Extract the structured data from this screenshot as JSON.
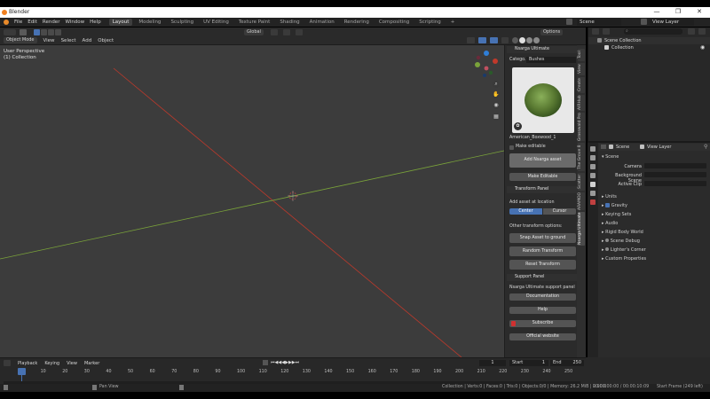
{
  "window": {
    "title": "Blender",
    "controls": [
      "—",
      "❐",
      "✕"
    ]
  },
  "menubar": {
    "menus": [
      "File",
      "Edit",
      "Render",
      "Window",
      "Help"
    ],
    "workspaces": [
      "Layout",
      "Modeling",
      "Sculpting",
      "UV Editing",
      "Texture Paint",
      "Shading",
      "Animation",
      "Rendering",
      "Compositing",
      "Scripting"
    ],
    "active_workspace": "Layout",
    "add_tab": "+",
    "scene": "Scene",
    "view_layer": "View Layer"
  },
  "viewport_header": {
    "mode": "Object Mode",
    "menus": [
      "View",
      "Select",
      "Add",
      "Object"
    ],
    "transform_orientation": "Global",
    "options": "Options"
  },
  "viewport": {
    "view_name": "User Perspective",
    "collection": "(1) Collection",
    "gizmo_axes": [
      "X",
      "Y",
      "Z"
    ]
  },
  "npanel": {
    "title": "Nsarga Ultimate",
    "category_label": "Catego...",
    "category_value": "Bushes",
    "asset_name": "American_Boxwood_1",
    "make_editable": "Make editable",
    "add_button": "Add Nsarga asset",
    "more_editable": "Make Editable",
    "transform_panel": "Transform Panel",
    "add_at_location": "Add asset at location",
    "location_options": [
      "Center",
      "Cursor"
    ],
    "location_active": "Center",
    "other_options": "Other transform options:",
    "snap_button": "Snap Asset to ground",
    "random_button": "Random Transform",
    "reset_button": "Reset Transform",
    "support_panel": "Support Panel",
    "support_label": "Nsarga Ultimate support panel",
    "documentation": "Documentation",
    "help": "Help",
    "subscribe": "Subscribe",
    "website": "Official website"
  },
  "vtabs": [
    "Tool",
    "View",
    "Create",
    "AIRHub",
    "Grasswald Pro",
    "The Grove 8",
    "Scatter",
    "ARAMOO",
    "Nsarga Ultimate"
  ],
  "outliner": {
    "search_placeholder": "",
    "root": "Scene Collection",
    "children": [
      "Collection"
    ]
  },
  "properties": {
    "scene_label": "Scene",
    "view_layer": "View Layer",
    "section_scene": "Scene",
    "camera_label": "Camera",
    "bg_scene_label": "Background Scene",
    "active_clip_label": "Active Clip",
    "sections": [
      "Units",
      "Gravity",
      "Keying Sets",
      "Audio",
      "Rigid Body World",
      "Scene Debug",
      "Lighter's Corner",
      "Custom Properties"
    ],
    "gravity_checked": true
  },
  "timeline": {
    "menus": [
      "Playback",
      "Keying",
      "View",
      "Marker"
    ],
    "current_frame": "1",
    "start_label": "Start",
    "start": "1",
    "end_label": "End",
    "end": "250",
    "ticks": [
      "0",
      "10",
      "20",
      "30",
      "40",
      "50",
      "60",
      "70",
      "80",
      "90",
      "100",
      "110",
      "120",
      "130",
      "140",
      "150",
      "160",
      "170",
      "180",
      "190",
      "200",
      "210",
      "220",
      "230",
      "240",
      "250"
    ]
  },
  "statusbar": {
    "left_hint": "Pan View",
    "stats": "Collection | Verts:0 | Faces:0 | Tris:0 | Objects:0/0 | Memory: 26.2 MiB | 2.90.0",
    "timecode": "00:00:00:00 / 00:00:10:09",
    "frame": "Start Frame (249 left)"
  },
  "colors": {
    "x_axis": "#c0392b",
    "y_axis": "#7aa33a",
    "z_axis": "#2f7fd8",
    "accent_blue": "#4772b3"
  }
}
